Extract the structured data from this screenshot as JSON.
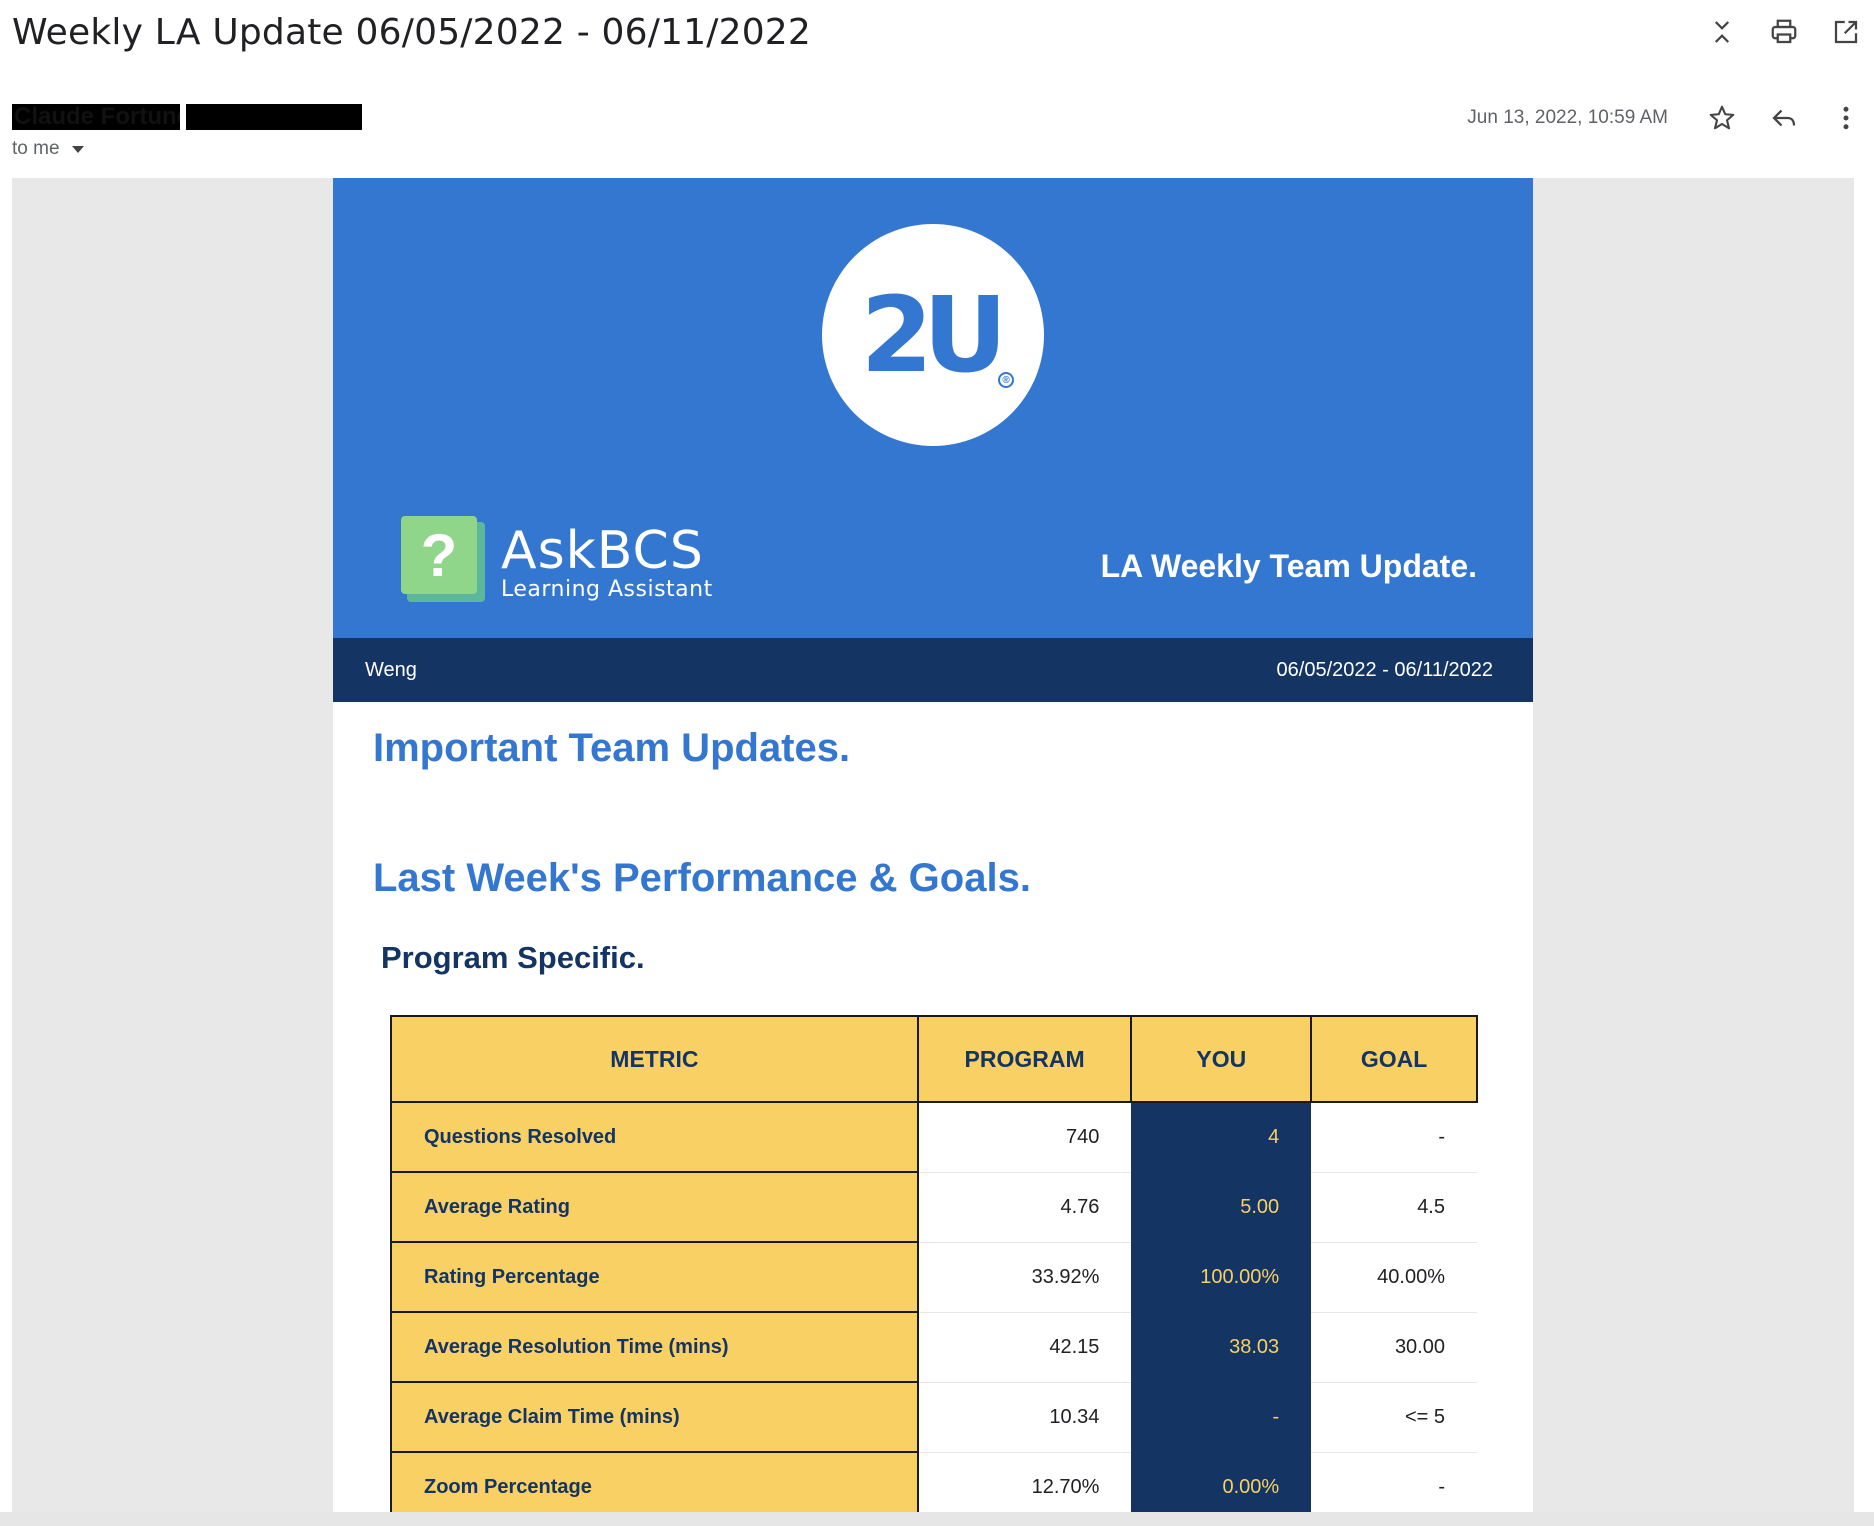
{
  "header": {
    "subject": "Weekly LA Update 06/05/2022 - 06/11/2022",
    "sender_name": "Claude Fortune",
    "recipient": "to me",
    "date": "Jun 13, 2022, 10:59 AM"
  },
  "icons": {
    "collapse": "collapse-icon",
    "print": "print-icon",
    "open_new": "open-in-new-window-icon",
    "star": "star-icon",
    "reply": "reply-icon",
    "more": "more-vert-icon"
  },
  "banner": {
    "logo_text": "2U",
    "logo_reg": "®",
    "ask_title": "AskBCS",
    "ask_subtitle": "Learning Assistant",
    "ask_badge": "?",
    "title": "LA Weekly Team Update."
  },
  "navbar": {
    "name": "Weng",
    "range": "06/05/2022 - 06/11/2022"
  },
  "sections": {
    "important": "Important Team Updates.",
    "performance": "Last Week's Performance & Goals.",
    "program": "Program Specific."
  },
  "table": {
    "headers": [
      "METRIC",
      "PROGRAM",
      "YOU",
      "GOAL"
    ],
    "rows": [
      {
        "metric": "Questions Resolved",
        "program": "740",
        "you": "4",
        "goal": "-"
      },
      {
        "metric": "Average Rating",
        "program": "4.76",
        "you": "5.00",
        "goal": "4.5"
      },
      {
        "metric": "Rating Percentage",
        "program": "33.92%",
        "you": "100.00%",
        "goal": "40.00%"
      },
      {
        "metric": "Average Resolution Time (mins)",
        "program": "42.15",
        "you": "38.03",
        "goal": "30.00"
      },
      {
        "metric": "Average Claim Time (mins)",
        "program": "10.34",
        "you": "-",
        "goal": "<= 5"
      },
      {
        "metric": "Zoom Percentage",
        "program": "12.70%",
        "you": "0.00%",
        "goal": "-"
      }
    ]
  },
  "colors": {
    "brand_blue": "#3477d1",
    "navy": "#143463",
    "gold": "#f8d064"
  }
}
